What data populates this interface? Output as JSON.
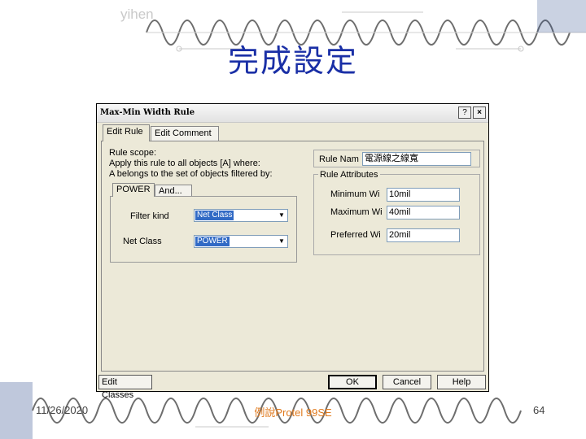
{
  "slide": {
    "author": "yihen",
    "title": "完成設定",
    "footer_date": "11/26/2020",
    "footer_center": "例說Protel 99SE",
    "page_number": "64"
  },
  "dialog": {
    "title": "Max-Min Width Rule",
    "help_icon": "?",
    "close_icon": "×",
    "tabs": [
      "Edit Rule",
      "Edit Comment"
    ],
    "scope_lines": [
      "Rule scope:",
      "Apply this rule to all objects [A] where:",
      "A belongs to the set of objects filtered by:"
    ],
    "inner_tabs": [
      "POWER",
      "And..."
    ],
    "filter_kind_label": "Filter kind",
    "filter_kind_value": "Net Class",
    "net_class_label": "Net Class",
    "net_class_value": "POWER",
    "rule_name_label": "Rule Nam",
    "rule_name_value": "電源線之線寬",
    "attributes_title": "Rule Attributes",
    "min_label": "Minimum Wi",
    "min_value": "10mil",
    "max_label": "Maximum Wi",
    "max_value": "40mil",
    "pref_label": "Preferred Wi",
    "pref_value": "20mil",
    "buttons": {
      "edit_classes": "Edit Classes",
      "ok": "OK",
      "cancel": "Cancel",
      "help": "Help"
    }
  }
}
